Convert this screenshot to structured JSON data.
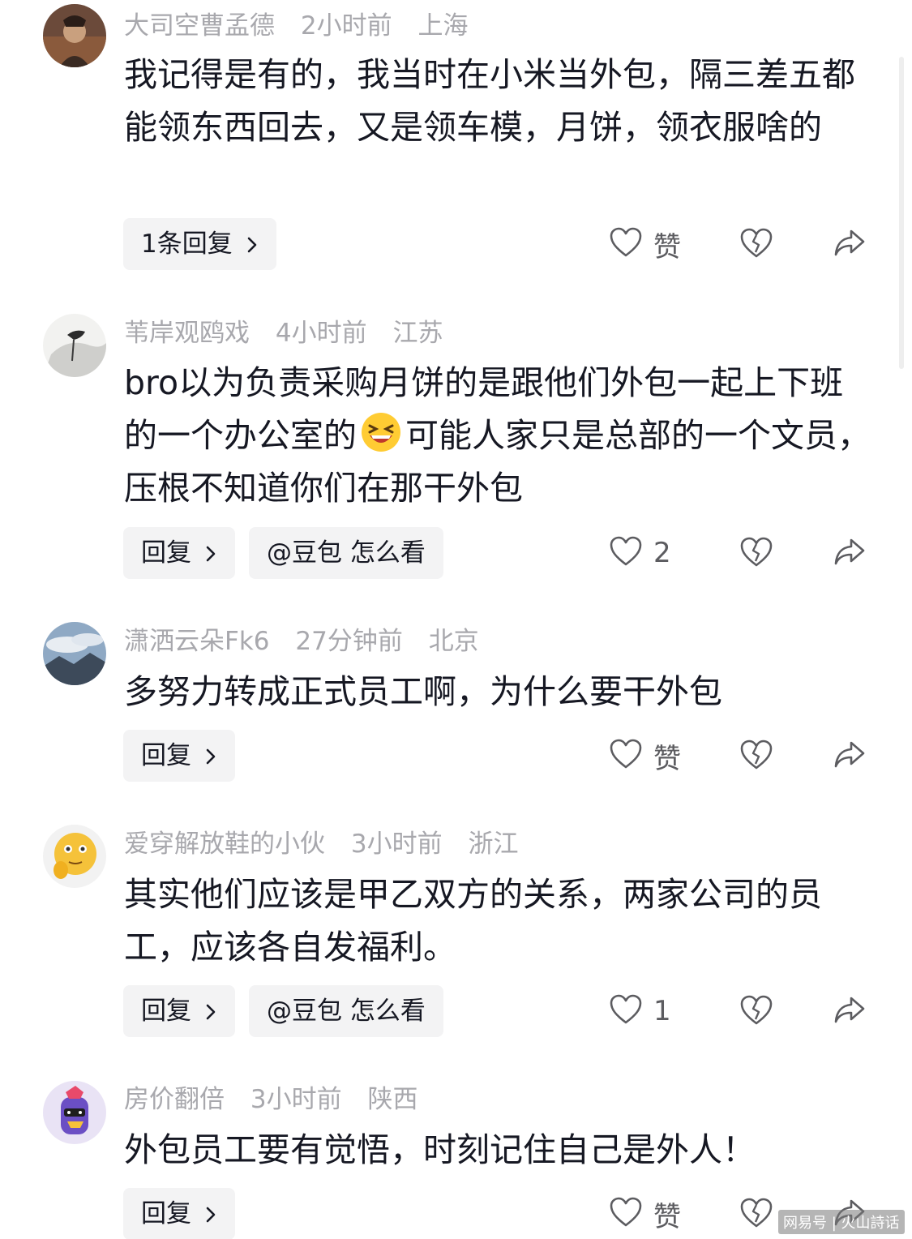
{
  "comments": [
    {
      "username": "大司空曹孟德",
      "time": "2小时前",
      "location": "上海",
      "text": "我记得是有的，我当时在小米当外包，隔三差五都能领东西回去，又是领车模，月饼，领衣服啥的",
      "reply_label": "1条回复",
      "like_label": "赞",
      "avatar_icon": "portrait-avatar"
    },
    {
      "username": "苇岸观鸥戏",
      "time": "4小时前",
      "location": "江苏",
      "text_before_emoji": "bro以为负责采购月饼的是跟他们外包一起上下班的一个办公室的",
      "emoji": "grinning-squint-emoji",
      "text_after_emoji": "可能人家只是总部的一个文员，压根不知道你们在那干外包",
      "reply_label": "回复",
      "ask_label": "@豆包 怎么看",
      "like_count": "2",
      "avatar_icon": "ink-painting-avatar"
    },
    {
      "username": "潇洒云朵Fk6",
      "time": "27分钟前",
      "location": "北京",
      "text": "多努力转成正式员工啊，为什么要干外包",
      "reply_label": "回复",
      "like_label": "赞",
      "avatar_icon": "mountain-sky-avatar"
    },
    {
      "username": "爱穿解放鞋的小伙",
      "time": "3小时前",
      "location": "浙江",
      "text": "其实他们应该是甲乙双方的关系，两家公司的员工，应该各自发福利。",
      "reply_label": "回复",
      "ask_label": "@豆包 怎么看",
      "like_count": "1",
      "avatar_icon": "thinking-emoji-avatar"
    },
    {
      "username": "房价翻倍",
      "time": "3小时前",
      "location": "陕西",
      "text": "外包员工要有觉悟，时刻记住自己是外人！",
      "reply_label": "回复",
      "like_label": "赞",
      "avatar_icon": "cartoon-character-avatar"
    }
  ],
  "icons": {
    "like": "heart-outline-icon",
    "dislike": "broken-heart-icon",
    "share": "share-arrow-icon",
    "chevron": "chevron-right-icon"
  },
  "watermark": "网易号 | 火山詩话",
  "colors": {
    "meta": "#a8a8ad",
    "text": "#161823",
    "pill_bg": "#f3f3f4"
  }
}
